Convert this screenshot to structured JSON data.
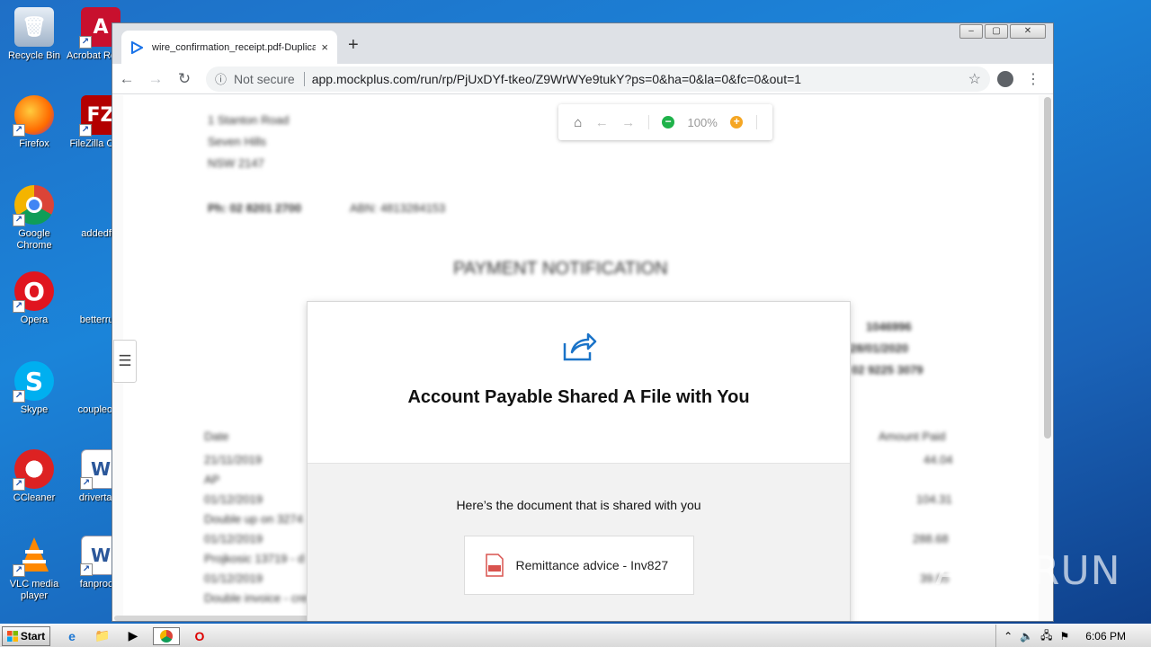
{
  "desktop": {
    "icons": [
      {
        "label": "Recycle Bin",
        "icon": "recycle-bin-icon"
      },
      {
        "label": "Acrobat Reader",
        "icon": "acrobat-reader-icon"
      },
      {
        "label": "Firefox",
        "icon": "firefox-icon"
      },
      {
        "label": "FileZilla Client",
        "icon": "filezilla-icon"
      },
      {
        "label": "Google Chrome",
        "icon": "chrome-icon"
      },
      {
        "label": "addedfar",
        "icon": "word-document-icon"
      },
      {
        "label": "Opera",
        "icon": "opera-icon"
      },
      {
        "label": "betterrule",
        "icon": "word-document-icon"
      },
      {
        "label": "Skype",
        "icon": "skype-icon"
      },
      {
        "label": "coupleope",
        "icon": "word-document-icon"
      },
      {
        "label": "CCleaner",
        "icon": "ccleaner-icon"
      },
      {
        "label": "drivertake",
        "icon": "word-document-icon"
      },
      {
        "label": "VLC media player",
        "icon": "vlc-icon"
      },
      {
        "label": "fanprocer",
        "icon": "word-document-icon"
      }
    ]
  },
  "browser": {
    "tab_title": "wire_confirmation_receipt.pdf-Duplicate",
    "tab_close": "×",
    "new_tab": "+",
    "window_controls": {
      "minimize": "–",
      "maximize": "▢",
      "close": "✕"
    },
    "security_label": "Not secure",
    "url": "app.mockplus.com/run/rp/PjUxDYf-tkeo/Z9WrWYe9tukY?ps=0&ha=0&la=0&fc=0&out=1"
  },
  "viewer": {
    "zoom": "100%",
    "colors": {
      "zoom_out": "#1fb24a",
      "zoom_in": "#f5a623"
    }
  },
  "document_blurred": {
    "address_line1": "1 Stanton Road",
    "address_line2": "Seven Hills",
    "address_line3": "NSW 2147",
    "phone": "Ph: 02 8201 2700",
    "abn": "ABN: 4813284153",
    "heading": "PAYMENT NOTIFICATION",
    "ref_number": "1046996",
    "ref_date": "28/01/2020",
    "ref_phone": "02 9225 3079",
    "col_date": "Date",
    "col_amount": "Amount Paid",
    "rows": [
      {
        "date": "21/11/2019",
        "desc": "AP",
        "amount": "44.04"
      },
      {
        "date": "01/12/2019",
        "desc": "Double up on 3274",
        "amount": "104.31"
      },
      {
        "date": "01/12/2019",
        "desc": "Projkosic 13719 - d",
        "amount": "288.68"
      },
      {
        "date": "01/12/2019",
        "desc": "Double invoice - cre",
        "amount": "39.85"
      }
    ]
  },
  "modal": {
    "title": "Account Payable Shared A File with You",
    "subtitle": "Here’s the document that is shared with you",
    "file_name": "Remittance advice - Inv827",
    "accent": "#1a73c8"
  },
  "watermark": "ANY RUN",
  "taskbar": {
    "start_label": "Start",
    "clock": "6:06 PM"
  }
}
